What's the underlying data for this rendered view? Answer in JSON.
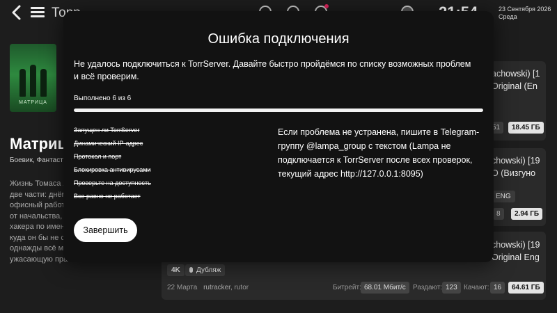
{
  "header": {
    "title": "Торр",
    "date": "23 Сентября 2026",
    "weekday": "Среда",
    "time": "21:54",
    "back_icon": "arrow-left-icon",
    "menu_icon": "hamburger-menu-icon"
  },
  "movie": {
    "poster_text": "МАТРИЦА",
    "title": "Матрица",
    "genres": "Боевик, Фантастика",
    "description_lines": [
      "Жизнь Томаса Андерсона",
      "две части: днём",
      "офисный работник,",
      "от начальства, а",
      "хакера по имени",
      "куда он бы не см",
      "однажды всё ме",
      "ужасающую прав"
    ]
  },
  "torrents": [
    {
      "name_lines": [
        "achowski) [1",
        "Original (En"
      ],
      "seeds": "51",
      "size": "18.45 ГБ"
    },
    {
      "name_lines": [
        "chowski) [19",
        "О (Визгуно"
      ],
      "lang": "ENG",
      "seeds": "8",
      "size": "2.94 ГБ"
    },
    {
      "name_lines": [
        "chowski) [19",
        "Original Eng"
      ],
      "quality": "4K",
      "audio": "Дубляж",
      "date": "22 Марта",
      "trackers": [
        "rutracker",
        "rutor"
      ],
      "bitrate_label": "Битрейт:",
      "bitrate": "68.01 Мбит/с",
      "seeders_label": "Раздают:",
      "seeders": "123",
      "leechers_label": "Качают:",
      "leechers": "16",
      "size": "64.61 ГБ"
    }
  ],
  "modal": {
    "title": "Ошибка подключения",
    "message": "Не удалось подключиться к TorrServer. Давайте быстро пройдёмся по списку возможных проблем и всё проверим.",
    "progress_label": "Выполнено 6 из 6",
    "progress": 1.0,
    "checks": [
      "Запущен ли TorrServer",
      "Динамический IP-адрес",
      "Протокол и порт",
      "Блокировка антивирусами",
      "Проверьте на доступность",
      "Все равно не работает"
    ],
    "help_text": "Если проблема не устранена, пишите в Telegram-группу @lampa_group с текстом (Lampa не подключается к TorrServer после всех проверок, текущий адрес http://127.0.0.1:8095)",
    "finish_label": "Завершить"
  },
  "colors": {
    "background": "#1d1d1d",
    "modal": "#121212",
    "accent": "#ffffff",
    "notification": "#e0245e"
  }
}
